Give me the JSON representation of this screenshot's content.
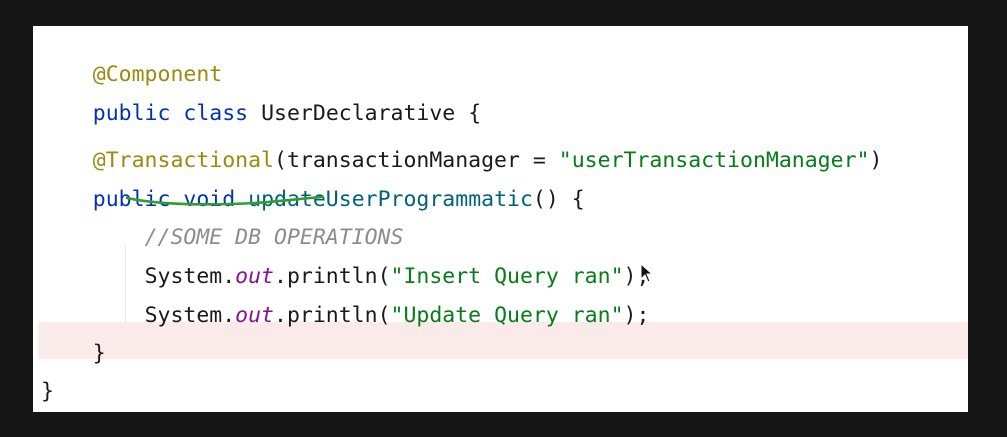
{
  "code": {
    "line1": {
      "annotation": "@Component"
    },
    "line2": {
      "kw_public": "public",
      "kw_class": "class",
      "class_name": "UserDeclarative",
      "brace": "{"
    },
    "line4": {
      "annotation": "@Transactional",
      "open_paren": "(",
      "param_name": "transactionManager",
      "equals": " = ",
      "param_value": "\"userTransactionManager\"",
      "close_paren": ")"
    },
    "line5": {
      "kw_public": "public",
      "kw_void": "void",
      "method_name": "updateUserProgrammatic",
      "signature_rest": "() {"
    },
    "line6": {
      "comment": "//SOME DB OPERATIONS"
    },
    "line7": {
      "receiver": "System.",
      "field": "out",
      "call": ".println(",
      "arg": "\"Insert Query ran\"",
      "end": ");"
    },
    "line8": {
      "receiver": "System.",
      "field": "out",
      "call": ".println(",
      "arg": "\"Update Query ran\"",
      "end": ");"
    },
    "line9": {
      "brace": "}"
    },
    "line10": {
      "brace": "}"
    }
  },
  "colors": {
    "annotation": "#9e880d",
    "keyword": "#0033b3",
    "string": "#067d17",
    "method": "#00627a",
    "static_field": "#871094",
    "comment": "#8c8c8c",
    "highlight": "#fbeaea",
    "squiggle": "#2e9e2e"
  },
  "icons": {
    "cursor": "mouse-pointer-icon"
  }
}
